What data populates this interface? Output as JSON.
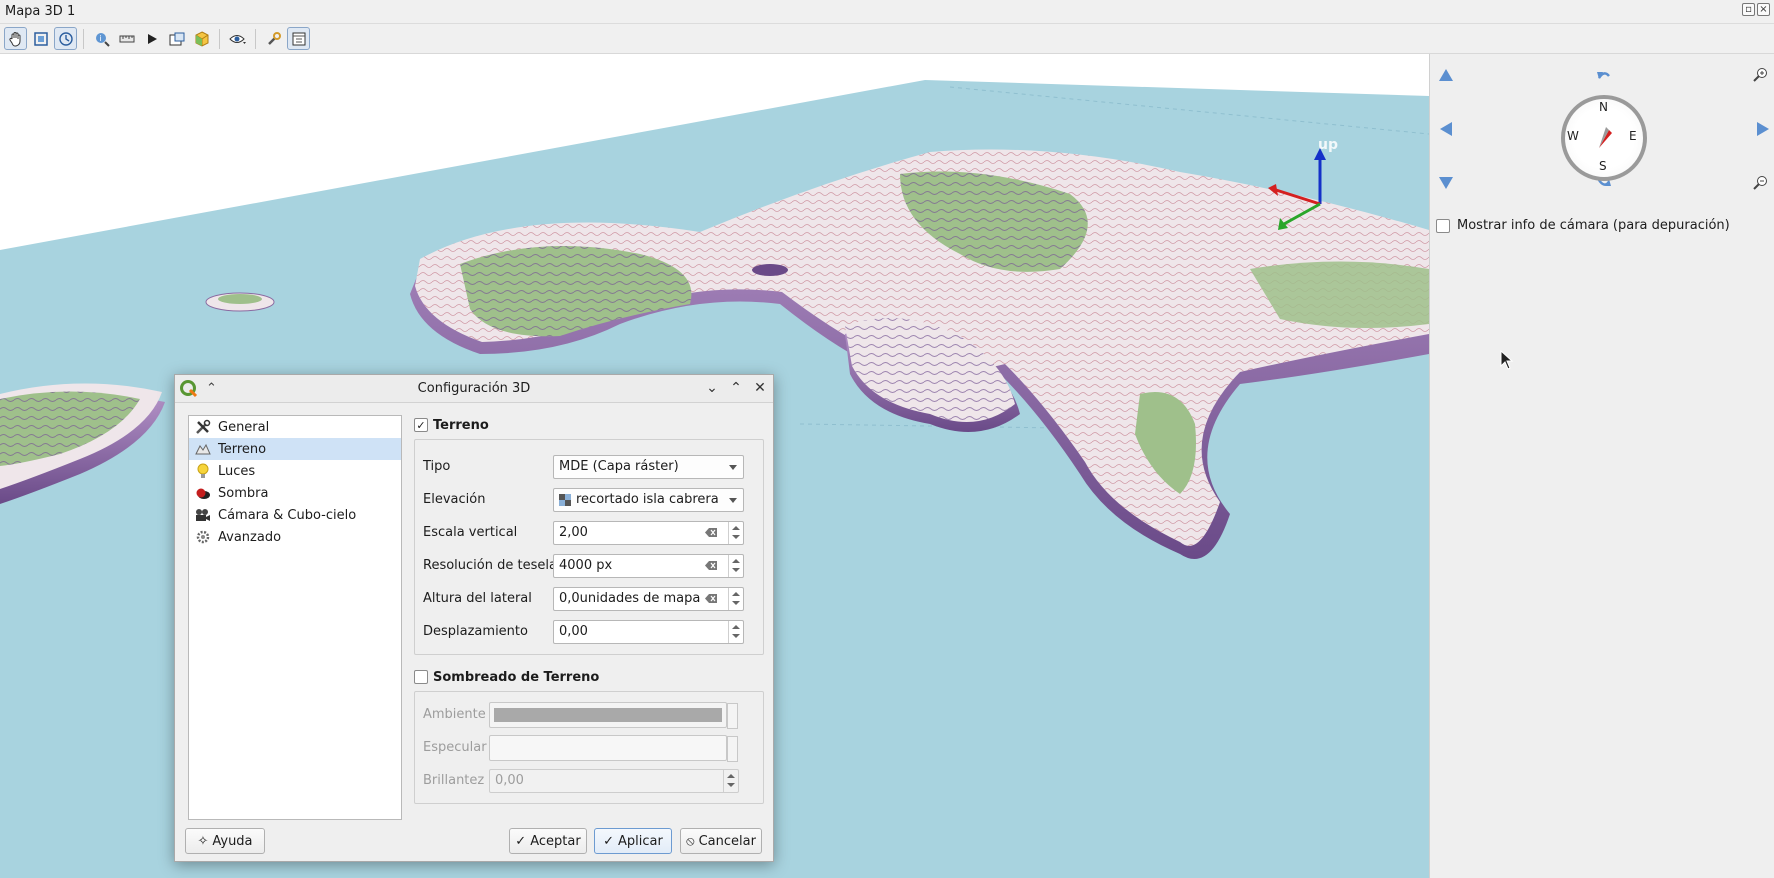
{
  "window": {
    "title": "Mapa 3D 1"
  },
  "toolbar": {
    "icons": [
      "pan-icon",
      "zoom-full-icon",
      "camera-view-icon",
      "identify-icon",
      "measure-icon",
      "animation-play-icon",
      "export-icon",
      "layers-3d-icon",
      "visibility-icon",
      "wrench-icon",
      "settings-icon"
    ]
  },
  "view3d": {
    "axis_label": "up",
    "colors": {
      "sea": "#a8d3df",
      "sky": "#ffffff",
      "land": "#efe6ea",
      "green": "#9fc08b",
      "purple": "#8a6aa0"
    }
  },
  "navigation": {
    "compass": {
      "n": "N",
      "s": "S",
      "e": "E",
      "w": "W"
    },
    "camera_info_label": "Mostrar info de cámara (para depuración)",
    "camera_info_checked": false
  },
  "dialog": {
    "title": "Configuración 3D",
    "nav_items": [
      {
        "label": "General",
        "icon": "tools-icon"
      },
      {
        "label": "Terreno",
        "icon": "terrain-icon"
      },
      {
        "label": "Luces",
        "icon": "lightbulb-icon"
      },
      {
        "label": "Sombra",
        "icon": "shadow-icon"
      },
      {
        "label": "Cámara & Cubo-cielo",
        "icon": "camera-icon"
      },
      {
        "label": "Avanzado",
        "icon": "gear-icon"
      }
    ],
    "selected_nav": "Terreno",
    "terrain": {
      "header": "Terreno",
      "checked": true,
      "tipo_label": "Tipo",
      "tipo_value": "MDE (Capa ráster)",
      "elevacion_label": "Elevación",
      "elevacion_value": "recortado isla cabrera",
      "escala_label": "Escala vertical",
      "escala_value": "2,00",
      "resolucion_label": "Resolución de tesela",
      "resolucion_value": "4000 px",
      "altura_label": "Altura del lateral",
      "altura_value": "0,0unidades de mapa",
      "desplazamiento_label": "Desplazamiento",
      "desplazamiento_value": "0,00"
    },
    "shading": {
      "header": "Sombreado de Terreno",
      "checked": false,
      "ambiente_label": "Ambiente",
      "especular_label": "Especular",
      "brillantez_label": "Brillantez",
      "brillantez_value": "0,00"
    },
    "buttons": {
      "help": "Ayuda",
      "accept": "Aceptar",
      "apply": "Aplicar",
      "cancel": "Cancelar"
    }
  }
}
